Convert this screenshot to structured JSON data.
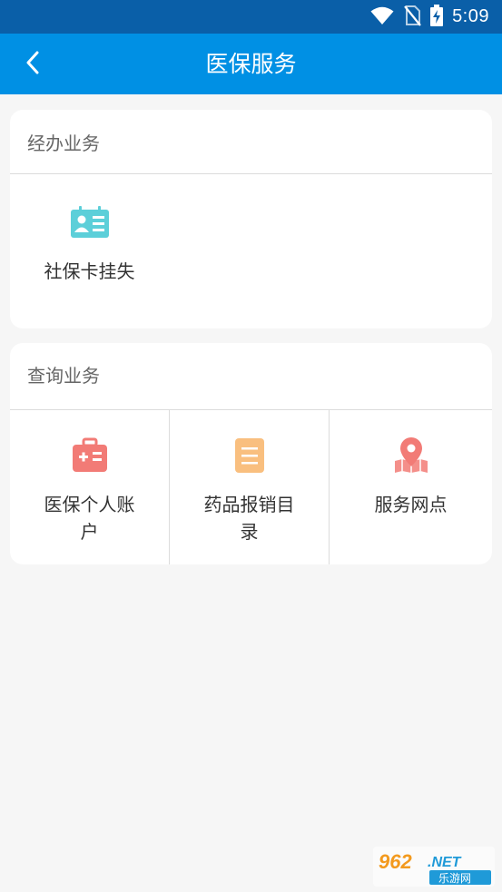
{
  "status_bar": {
    "time": "5:09",
    "icons": [
      "wifi-icon",
      "no-sim-icon",
      "battery-charging-icon"
    ]
  },
  "app_bar": {
    "back_icon": "chevron-left-icon",
    "title": "医保服务"
  },
  "sections": [
    {
      "header": "经办业务",
      "items": [
        {
          "label": "社保卡挂失",
          "icon": "id-card-icon",
          "color": "#5ccfd9"
        }
      ]
    },
    {
      "header": "查询业务",
      "items": [
        {
          "label": "医保个人账户",
          "icon": "medical-kit-icon",
          "color": "#f27b76"
        },
        {
          "label": "药品报销目录",
          "icon": "document-list-icon",
          "color": "#f9bf7f"
        },
        {
          "label": "服务网点",
          "icon": "map-pin-icon",
          "color": "#f27b76"
        }
      ]
    }
  ],
  "watermark": {
    "text_top": "962.NET",
    "text_bottom": "乐游网"
  },
  "colors": {
    "status_bar": "#0a5fa8",
    "app_bar": "#0090e4",
    "background": "#f6f6f6"
  }
}
